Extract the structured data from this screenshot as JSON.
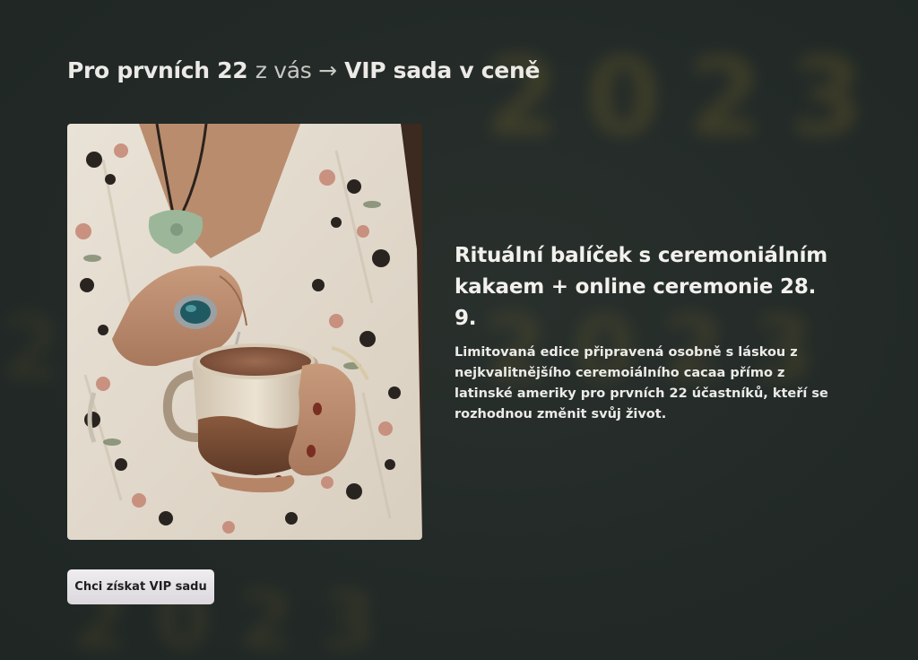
{
  "header": {
    "headline_start": "Pro prvních 22",
    "headline_mid": "z vás →",
    "headline_end": "VIP sada v ceně"
  },
  "offer": {
    "title": "Rituální balíček s ceremoniálním kakaem + online ceremonie 28. 9.",
    "description": "Limitovaná edice připravená osobně s láskou z nejkvalitnějšího ceremoiálního cacaa přímo z latinské ameriky pro prvních 22 účastníků, kteří se rozhodnou změnit svůj život."
  },
  "cta": {
    "label": "Chci získat VIP sadu"
  },
  "background": {
    "year_text": "2023"
  },
  "colors": {
    "background": "#232a27",
    "accent_blur": "#c7a22e",
    "button": "#e6e3e8",
    "text": "#f3f1ed"
  }
}
